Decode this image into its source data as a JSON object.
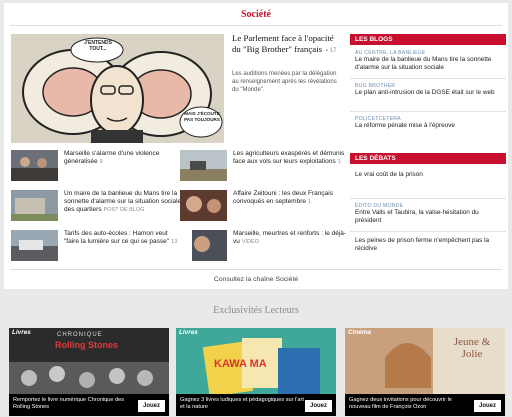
{
  "section": {
    "title": "Société",
    "consult_link": "Consultez la chaîne Société"
  },
  "hero": {
    "cartoon_text_left": "J'ENTENDS TOUT...",
    "cartoon_text_right": "MAIS J'ÉCOUTE PAS TOUJOURS",
    "title": "Le Parlement face à l'opacité du \"Big Brother\" français",
    "count": "17",
    "description": "Les auditions menées par la délégation au renseignement après les révélations du \"Monde\"."
  },
  "articles": [
    {
      "title": "Marseille s'alarme d'une violence généralisée",
      "tag": "9"
    },
    {
      "title": "Les agriculteurs exaspérés et démunis face aux vols sur leurs exploitations",
      "tag": "1"
    },
    {
      "title": "Un maire de la banlieue du Mans tire la sonnette d'alarme sur la situation sociale des quartiers",
      "tag": "POST DE BLOG"
    },
    {
      "title": "Affaire Zeitouni : les deux Français convoqués en septembre",
      "tag": "1"
    },
    {
      "title": "Tarifs des auto-écoles : Hamon veut \"faire la lumière sur ce qui se passe\"",
      "tag": "13"
    },
    {
      "title": "Marseille, meurtres et renforts : le déjà-vu",
      "tag": "VIDÉO"
    }
  ],
  "sidebar": {
    "blogs_header": "LES BLOGS",
    "blogs": [
      {
        "kicker": "AU CENTRE, LA BANLIEUE",
        "title": "Le maire de la banlieue du Mans tire la sonnette d'alarme sur la situation sociale"
      },
      {
        "kicker": "BUG BROTHER",
        "title": "Le plan anti-intrusion de la DGSE était sur le web"
      },
      {
        "kicker": "POLICETCETERA",
        "title": "La réforme pénale mise à l'épreuve"
      }
    ],
    "debates_header": "LES DÉBATS",
    "debates": [
      {
        "kicker": "",
        "title": "Le vrai coût de la prison"
      },
      {
        "kicker": "ÉDITO DU MONDE",
        "title": "Entre Valls et Taubira, la valse-hésitation du président"
      },
      {
        "kicker": "",
        "title": "Les peines de prison ferme n'empêchent pas la récidive"
      }
    ]
  },
  "exclusivites": {
    "title": "Exclusivités Lecteurs",
    "cards": [
      {
        "badge": "Livres",
        "image_label": "CHRONIQUE",
        "image_title": "Rolling Stones",
        "caption": "Remportez le livre numérique Chronique des Rolling Stones",
        "button": "Jouez"
      },
      {
        "badge": "Livres",
        "image_label": "KAWA MA",
        "image_title": "",
        "caption": "Gagnez 3 livres ludiques et pédagogiques sur l'art et la nature",
        "button": "Jouez"
      },
      {
        "badge": "Cinéma",
        "image_label": "Jeune & Jolie",
        "image_title": "",
        "caption": "Gagnez deux invitations pour découvrir le nouveau film de François Ozon",
        "button": "Jouez"
      }
    ]
  },
  "colors": {
    "accent": "#c8102e",
    "kicker": "#6d8fb0",
    "background": "#e9e9e9"
  }
}
